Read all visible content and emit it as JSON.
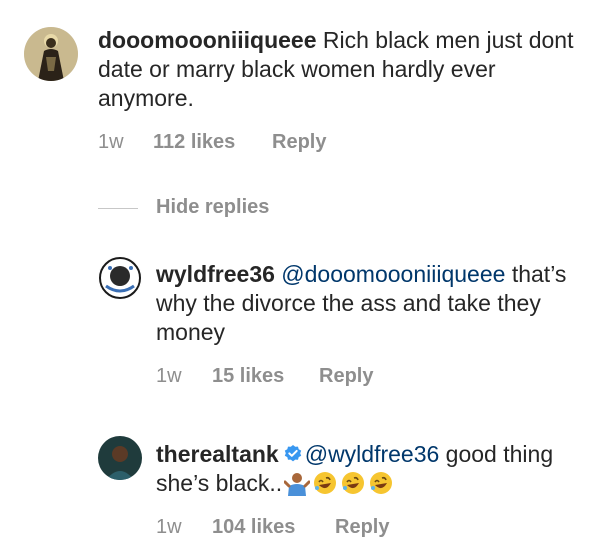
{
  "colors": {
    "text": "#262626",
    "meta": "#8e8e8e",
    "mention": "#00376b",
    "verified": "#3897f0"
  },
  "comments": [
    {
      "username": "dooomoooniiiqueee",
      "text": "Rich black men just dont date or marry black women hardly ever anymore.",
      "time": "1w",
      "likes": "112 likes",
      "reply": "Reply",
      "avatar_icon": "robed-figure-avatar"
    }
  ],
  "hide_replies": "Hide replies",
  "replies": [
    {
      "username": "wyldfree36",
      "mention": "@dooomoooniiiqueee",
      "text": " that’s why the divorce the ass and take they money",
      "time": "1w",
      "likes": "15 likes",
      "reply": "Reply",
      "avatar_icon": "decorated-logo-avatar"
    },
    {
      "username": "therealtank",
      "verified_icon": "verified-badge-icon",
      "mention": "@wyldfree36",
      "text": " good thing she’s black..",
      "emojis": [
        "man-shrugging-emoji",
        "rofl-emoji",
        "rofl-emoji",
        "rofl-emoji"
      ],
      "time": "1w",
      "likes": "104 likes",
      "reply": "Reply",
      "avatar_icon": "man-portrait-avatar"
    }
  ]
}
